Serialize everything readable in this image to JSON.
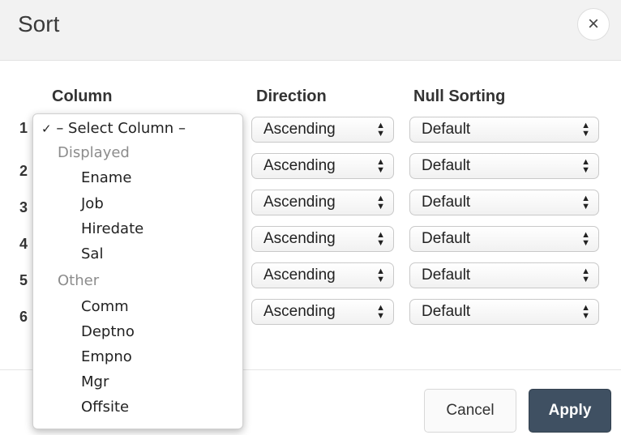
{
  "dialog": {
    "title": "Sort",
    "close_icon": "×"
  },
  "columns": {
    "column": "Column",
    "direction": "Direction",
    "null_sorting": "Null Sorting"
  },
  "rows": [
    {
      "number": "1",
      "direction": "Ascending",
      "null_sorting": "Default"
    },
    {
      "number": "2",
      "direction": "Ascending",
      "null_sorting": "Default"
    },
    {
      "number": "3",
      "direction": "Ascending",
      "null_sorting": "Default"
    },
    {
      "number": "4",
      "direction": "Ascending",
      "null_sorting": "Default"
    },
    {
      "number": "5",
      "direction": "Ascending",
      "null_sorting": "Default"
    },
    {
      "number": "6",
      "direction": "Ascending",
      "null_sorting": "Default"
    }
  ],
  "column_dropdown": {
    "selected_check": "✓",
    "selected_label": "– Select Column –",
    "groups": [
      {
        "label": "Displayed",
        "items": [
          "Ename",
          "Job",
          "Hiredate",
          "Sal"
        ]
      },
      {
        "label": "Other",
        "items": [
          "Comm",
          "Deptno",
          "Empno",
          "Mgr",
          "Offsite"
        ]
      }
    ]
  },
  "footer": {
    "cancel_label": "Cancel",
    "apply_label": "Apply"
  },
  "colors": {
    "apply_background": "#3f5062",
    "header_background": "#f2f2f2"
  }
}
